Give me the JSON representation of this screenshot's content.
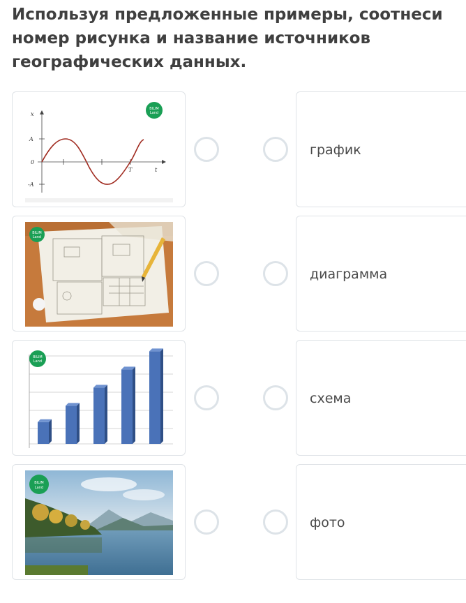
{
  "question": "Используя предложенные примеры, соотнеси номер рисунка и название источников географических данных.",
  "pictures": [
    {
      "alt": "wave-graph",
      "logo_line1": "BILIM",
      "logo_line2": "Land",
      "axis_labels": {
        "y": "x",
        "amp": "A",
        "zero": "0",
        "neg": "-A",
        "period": "T",
        "t": "t"
      }
    },
    {
      "alt": "plan-scheme",
      "logo_line1": "BILIM",
      "logo_line2": "Land"
    },
    {
      "alt": "bar-diagram",
      "logo_line1": "BILIM",
      "logo_line2": "Land",
      "bar_values": [
        1.2,
        2.1,
        3.1,
        4.1,
        5.1
      ]
    },
    {
      "alt": "landscape-photo",
      "logo_line1": "BILIM",
      "logo_line2": "Land"
    }
  ],
  "options": [
    {
      "label": "график"
    },
    {
      "label": "диаграмма"
    },
    {
      "label": "схема"
    },
    {
      "label": "фото"
    }
  ],
  "colors": {
    "logo_green": "#1a9f55",
    "wave": "#a02b20",
    "bar": "#4a72b8",
    "radio_border": "#dde3e8"
  }
}
